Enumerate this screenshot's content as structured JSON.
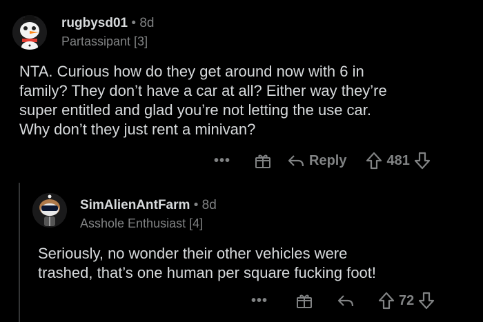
{
  "comments": [
    {
      "username": "rugbysd01",
      "separator": "•",
      "age": "8d",
      "flair": "Partassipant [3]",
      "body": "NTA. Curious how do they get around now with 6 in\nfamily?  They don’t have a car at all?  Either way they’re\nsuper entitled and glad you’re not letting the use car.\nWhy don’t they just rent a minivan?",
      "more_label": "•••",
      "reply_label": "Reply",
      "votes": "481"
    },
    {
      "username": "SimAlienAntFarm",
      "separator": "•",
      "age": "8d",
      "flair": "Asshole Enthusiast [4]",
      "body": "Seriously, no wonder their other vehicles were\ntrashed, that’s one human per square fucking foot!",
      "more_label": "•••",
      "votes": "72"
    }
  ],
  "icons": {
    "more": "more-options-icon",
    "award": "gift-icon",
    "reply": "reply-arrow-icon",
    "upvote": "upvote-arrow-icon",
    "downvote": "downvote-arrow-icon"
  },
  "colors": {
    "background": "#000000",
    "text": "#d7dadc",
    "muted": "#818384"
  }
}
